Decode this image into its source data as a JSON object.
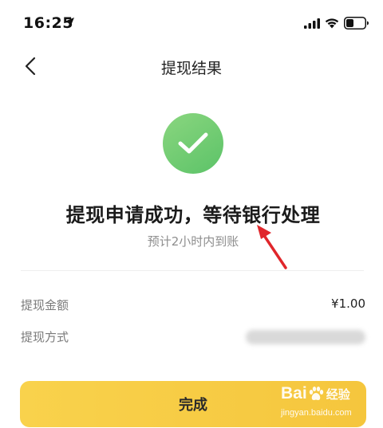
{
  "status_bar": {
    "time": "16:25",
    "icons": [
      "location-arrow-icon",
      "signal-icon",
      "wifi-icon",
      "battery-icon"
    ]
  },
  "nav": {
    "back_icon": "chevron-left-icon",
    "title": "提现结果"
  },
  "result": {
    "icon": "checkmark-icon",
    "icon_color": "#6ECB6F",
    "title": "提现申请成功，等待银行处理",
    "subtitle": "预计2小时内到账"
  },
  "details": [
    {
      "label": "提现金额",
      "value": "¥1.00"
    },
    {
      "label": "提现方式",
      "value": ""
    }
  ],
  "actions": {
    "done_label": "完成",
    "button_color": "#F7CC45"
  },
  "watermark": {
    "brand_left": "Bai",
    "brand_right": "经验",
    "url": "jingyan.baidu.com"
  },
  "annotation": {
    "arrow_color": "#E0262B"
  }
}
